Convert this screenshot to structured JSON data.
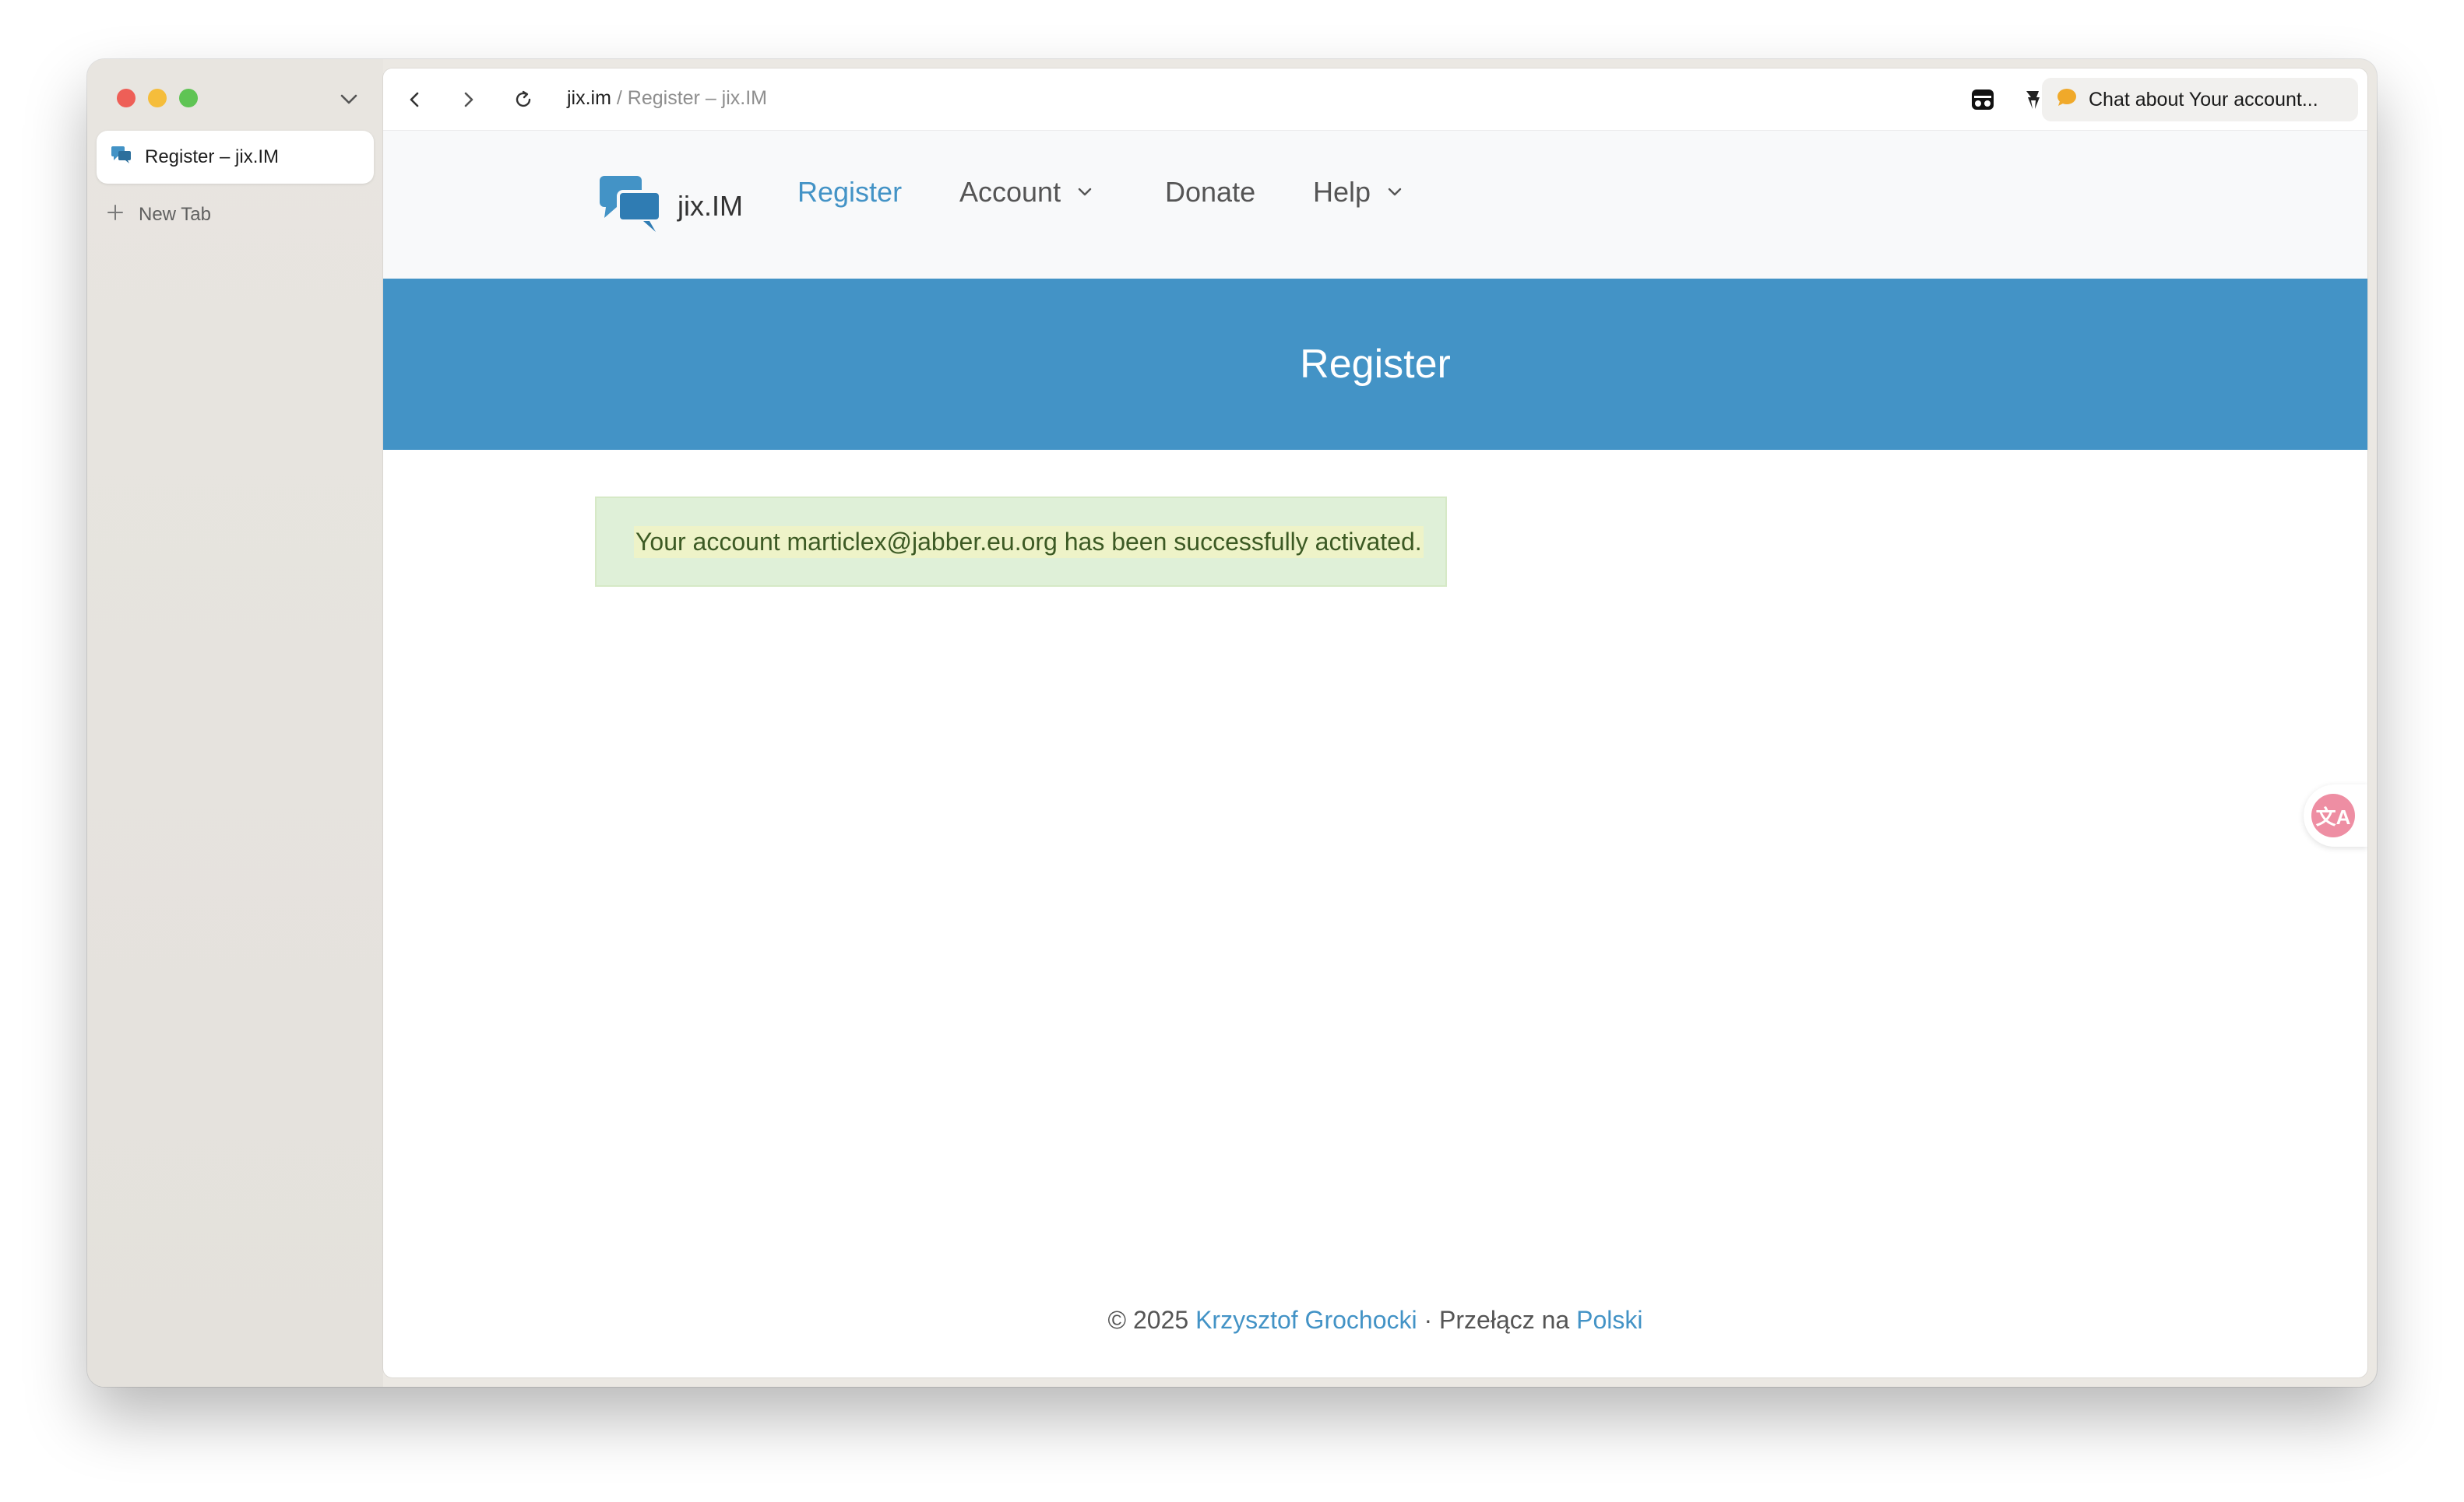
{
  "browser": {
    "tabs": [
      {
        "label": "Register – jix.IM",
        "active": true
      },
      {
        "label": "New Tab",
        "active": false
      }
    ],
    "url": {
      "domain": "jix.im",
      "separator": " / ",
      "page_title": "Register – jix.IM"
    },
    "chat_button_label": "Chat about Your account..."
  },
  "site": {
    "brand": "jix.IM",
    "nav": [
      {
        "label": "Register",
        "active": true,
        "dropdown": false
      },
      {
        "label": "Account",
        "active": false,
        "dropdown": true
      },
      {
        "label": "Donate",
        "active": false,
        "dropdown": false
      },
      {
        "label": "Help",
        "active": false,
        "dropdown": true
      }
    ],
    "hero_title": "Register",
    "alert_message": "Your account marticlex@jabber.eu.org has been successfully activated.",
    "footer": {
      "copyright": "© 2025 ",
      "author": "Krzysztof Grochocki",
      "middle": " · Przełącz na ",
      "language": "Polski"
    }
  },
  "translate_fab": {
    "glyph": "文A"
  },
  "colors": {
    "accent": "#4393c6",
    "alert_bg": "#dff0d8",
    "alert_text": "#3c5a24",
    "nav_bg": "#f8f9fa"
  }
}
